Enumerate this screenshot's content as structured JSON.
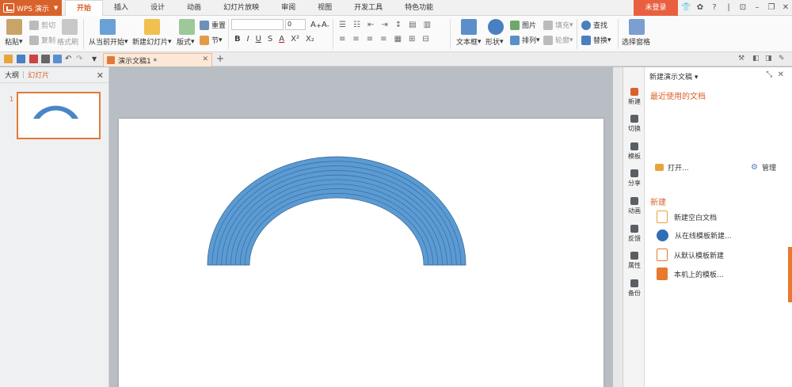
{
  "app": {
    "name": "WPS 演示",
    "login_label": "未登录"
  },
  "menu_tabs": [
    "开始",
    "插入",
    "设计",
    "动画",
    "幻灯片放映",
    "审阅",
    "视图",
    "开发工具",
    "特色功能"
  ],
  "ribbon": {
    "paste": "粘贴",
    "cut": "剪切",
    "copy": "复制",
    "format_painter": "格式刷",
    "from_current": "从当前开始",
    "new_slide": "新建幻灯片",
    "layout": "版式",
    "reset": "重置",
    "section": "节",
    "font_size": "0",
    "textbox": "文本框",
    "shape": "形状",
    "picture": "图片",
    "fill": "填充",
    "arrange": "排列",
    "outline": "轮廓",
    "find": "查找",
    "replace": "替换",
    "selection_pane": "选择窗格"
  },
  "document_tab": {
    "title": "演示文稿1 *"
  },
  "left_panel": {
    "outline_tab": "大纲",
    "slides_tab": "幻灯片",
    "slide_number": "1"
  },
  "rail": [
    "新建",
    "切换",
    "模板",
    "分享",
    "动画",
    "反馈",
    "属性",
    "备份"
  ],
  "task_pane": {
    "title": "新建演示文稿",
    "recent_heading": "最近使用的文档",
    "open_label": "打开...",
    "manage_label": "管理",
    "new_heading": "新建",
    "items": [
      "新建空白文档",
      "从在线模板新建...",
      "从默认模板新建",
      "本机上的模板..."
    ]
  },
  "colors": {
    "accent": "#d9622b",
    "arc_fill": "#5b9bd5",
    "arc_stroke": "#3c6b93"
  }
}
